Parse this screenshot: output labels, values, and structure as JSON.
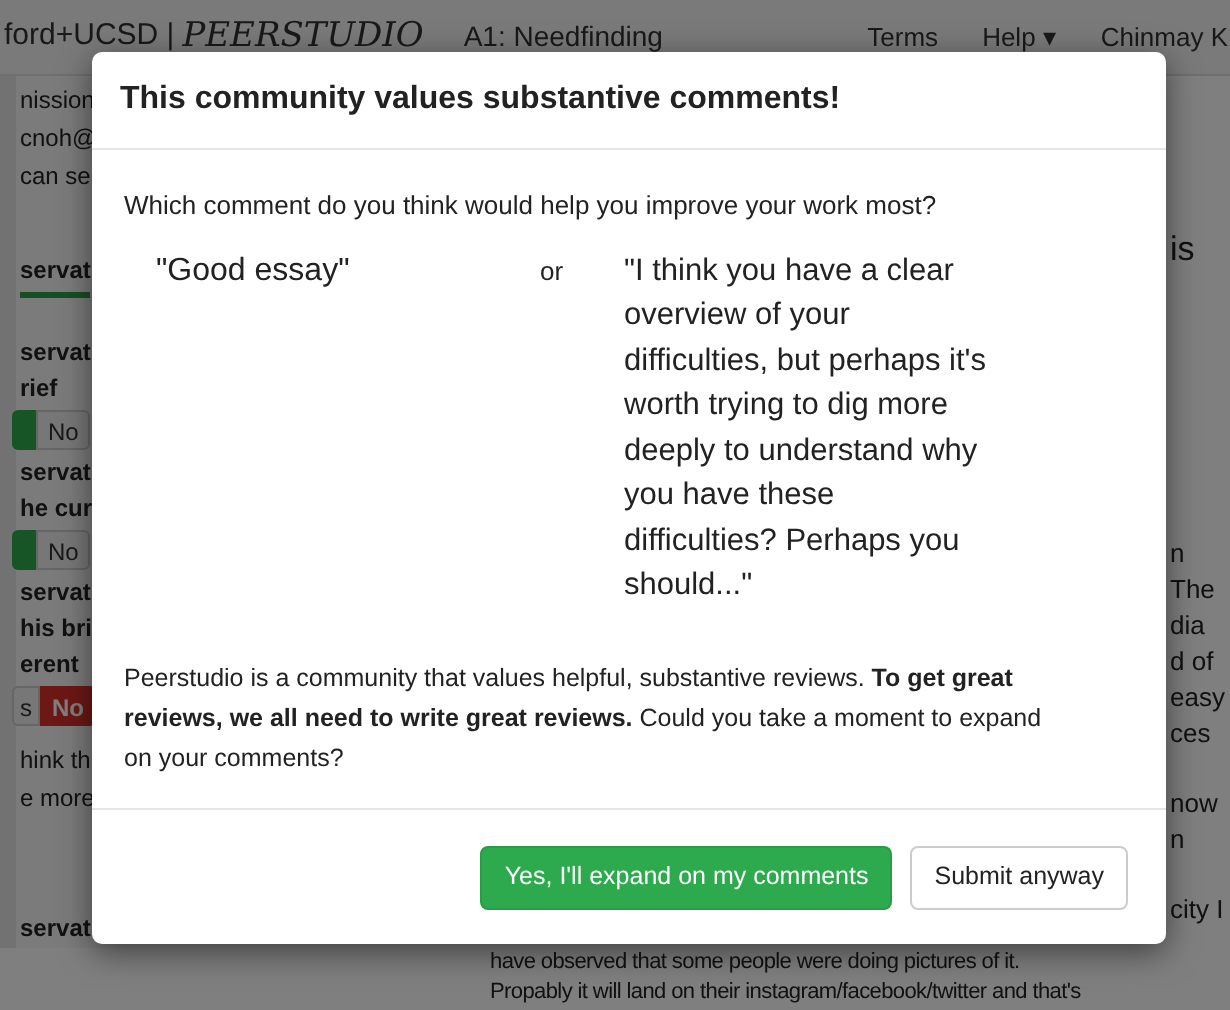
{
  "navbar": {
    "brand": "ford+UCSD |",
    "logo": "PEERSTUDIO",
    "assignment": "A1: Needfinding",
    "links": [
      "Terms",
      "Help ▾",
      "Chinmay K"
    ]
  },
  "left_panel": [
    {
      "kind": "meta",
      "text": "nission"
    },
    {
      "kind": "meta",
      "text": "cnoh@"
    },
    {
      "kind": "meta",
      "text": "can se"
    },
    {
      "kind": "tab",
      "text": "servat"
    },
    {
      "kind": "question",
      "text": "servat"
    },
    {
      "kind": "question",
      "text": "rief"
    },
    {
      "kind": "toggle",
      "yes_selected": true,
      "no_label": "No"
    },
    {
      "kind": "question",
      "text": "servat"
    },
    {
      "kind": "question",
      "text": "he cur"
    },
    {
      "kind": "toggle",
      "yes_selected": true,
      "no_label": "No"
    },
    {
      "kind": "question",
      "text": "servat"
    },
    {
      "kind": "question",
      "text": "his bri"
    },
    {
      "kind": "question",
      "text": "erent"
    },
    {
      "kind": "toggle",
      "yes_selected": false,
      "yes_label": "s",
      "no_label": "No"
    },
    {
      "kind": "comment",
      "text": "hink th"
    },
    {
      "kind": "comment",
      "text": "e more"
    },
    {
      "kind": "section",
      "text": "servat"
    }
  ],
  "right_fragments": [
    {
      "kind": "heading",
      "text": "is"
    },
    {
      "kind": "line",
      "text": "n"
    },
    {
      "kind": "line",
      "text": "The"
    },
    {
      "kind": "line",
      "text": "dia"
    },
    {
      "kind": "line",
      "text": "d of"
    },
    {
      "kind": "line",
      "text": "easy"
    },
    {
      "kind": "line",
      "text": "ces"
    },
    {
      "kind": "gap_line",
      "text": "now"
    },
    {
      "kind": "line",
      "text": "n"
    },
    {
      "kind": "gap_line",
      "text": "city I"
    }
  ],
  "bottom_lines": [
    "have observed that some people were doing pictures of it.",
    "Propably it will land on their instagram/facebook/twitter and that's"
  ],
  "dialog": {
    "title": "This community values substantive comments!",
    "question": "Which comment do you think would help you improve your work most?",
    "option_a": "\"Good essay\"",
    "separator": "or",
    "option_b": "\"I think you have a clear overview of your difficulties, but perhaps it's worth trying to dig more deeply to understand why you have these difficulties? Perhaps you should...\"",
    "message": "Peerstudio is a community that values helpful, substantive reviews. **To get great reviews, we all need to write great reviews.** Could you take a moment to expand on your comments?",
    "buttons": [
      {
        "kind": "primary",
        "label": "Yes, I'll expand on my comments"
      },
      {
        "kind": "default",
        "label": "Submit anyway"
      }
    ]
  }
}
